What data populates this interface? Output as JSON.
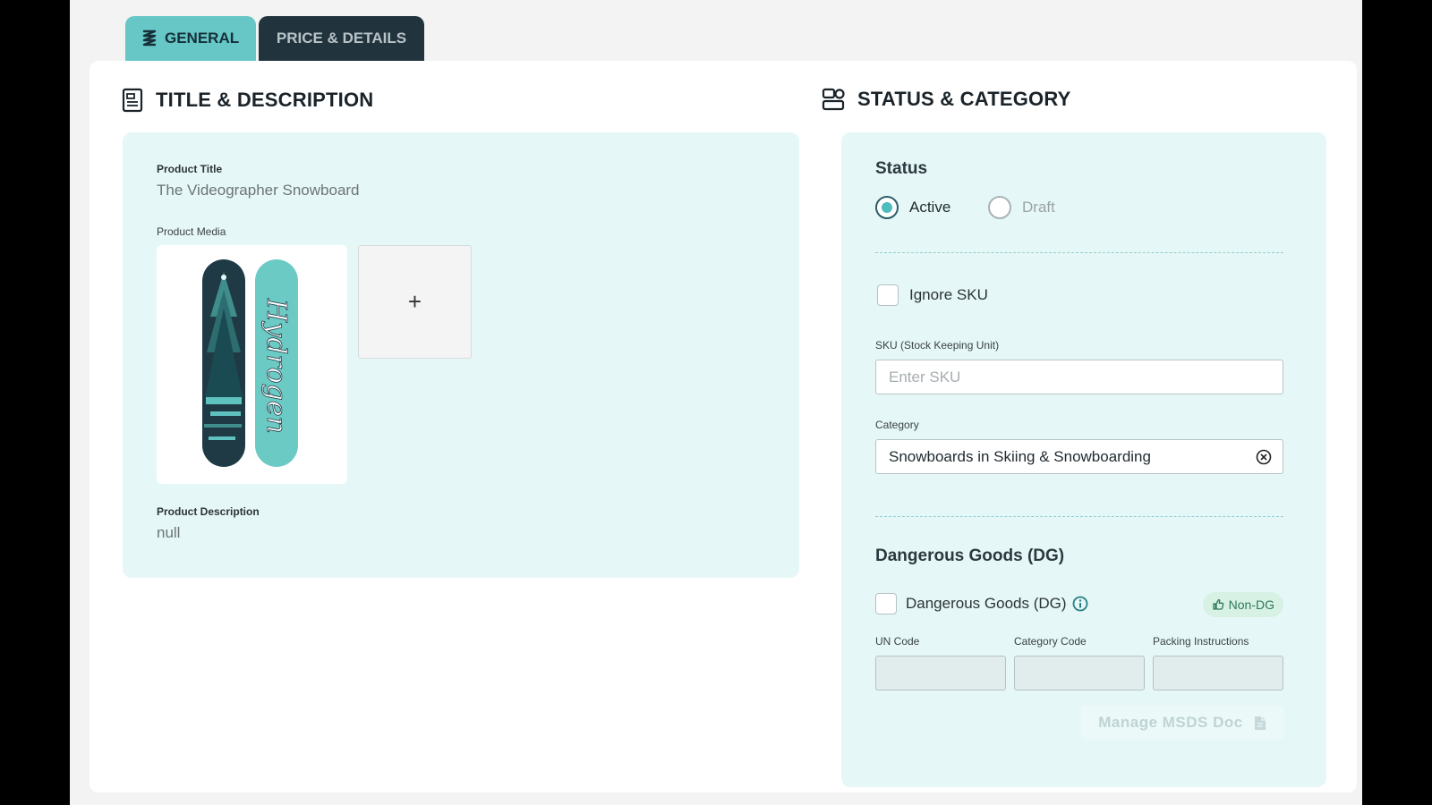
{
  "tabs": {
    "general": "GENERAL",
    "price": "PRICE & DETAILS"
  },
  "left": {
    "section_title": "TITLE & DESCRIPTION",
    "product_title_label": "Product Title",
    "product_title_value": "The Videographer Snowboard",
    "product_media_label": "Product Media",
    "add_media": "+",
    "board_text": "Hydrogen",
    "product_description_label": "Product Description",
    "product_description_value": "null"
  },
  "right": {
    "section_title": "STATUS & CATEGORY",
    "status_heading": "Status",
    "status_options": [
      "Active",
      "Draft"
    ],
    "status_selected": "Active",
    "ignore_sku_label": "Ignore SKU",
    "sku_label": "SKU (Stock Keeping Unit)",
    "sku_placeholder": "Enter SKU",
    "category_label": "Category",
    "category_value": "Snowboards in Skiing & Snowboarding",
    "dg_heading": "Dangerous Goods (DG)",
    "dg_checkbox_label": "Dangerous Goods (DG)",
    "dg_badge": "Non-DG",
    "un_code_label": "UN Code",
    "category_code_label": "Category Code",
    "packing_instructions_label": "Packing Instructions",
    "msds_button": "Manage MSDS Doc"
  },
  "colors": {
    "accent": "#66c7c6",
    "tab_dark": "#21343d",
    "panel_bg": "#e6f7f7",
    "badge_bg": "#d7f1e5",
    "badge_text": "#2d7a58"
  },
  "icons": [
    "layers-icon",
    "document-icon",
    "status-category-icon",
    "clear-circle-icon",
    "info-icon",
    "thumbs-up-icon",
    "file-icon"
  ]
}
